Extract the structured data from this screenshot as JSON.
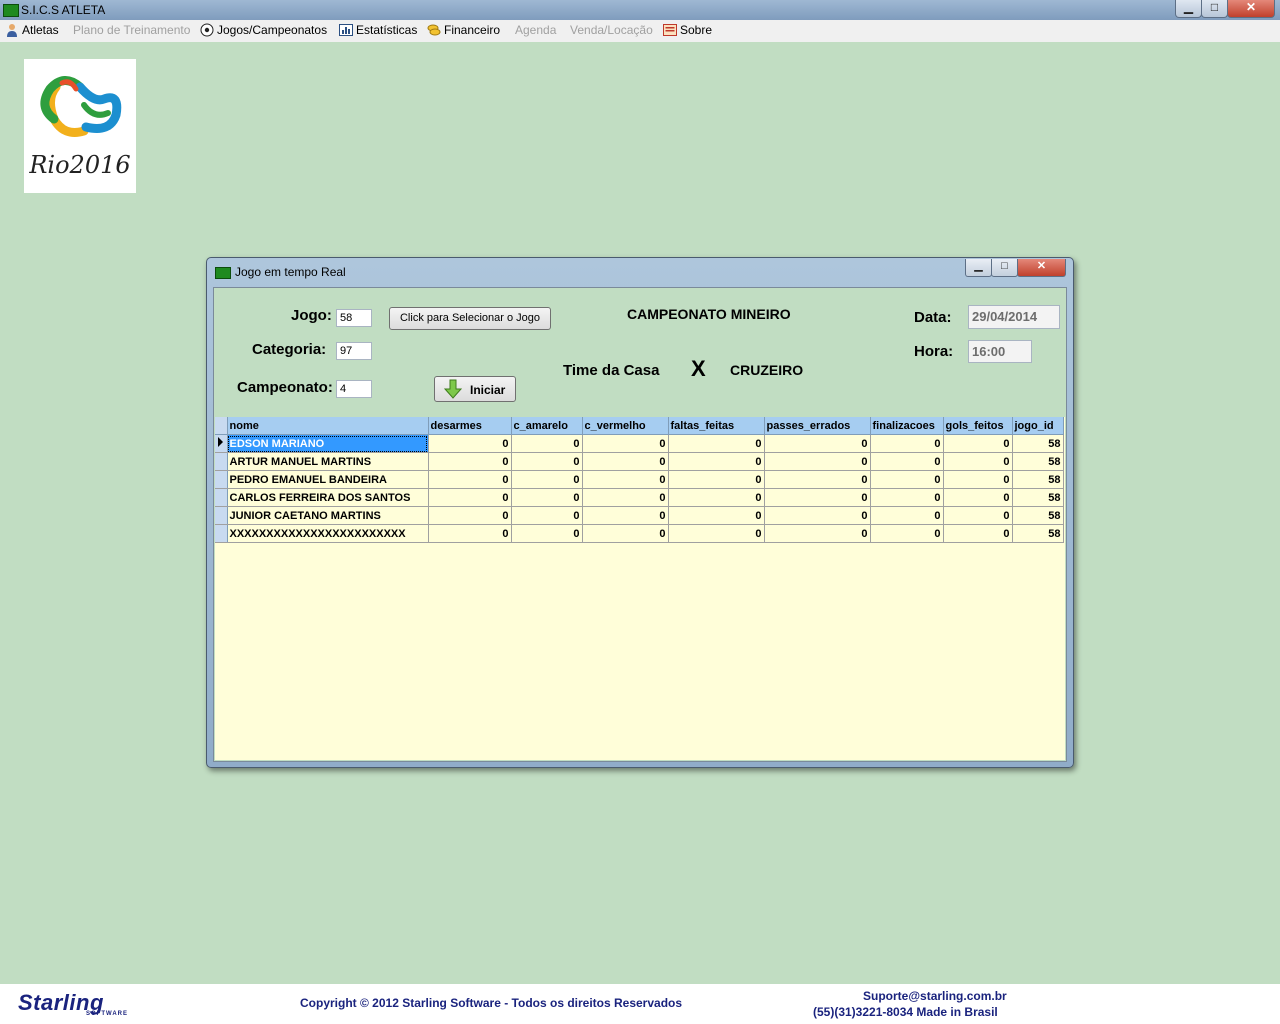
{
  "window": {
    "title": "S.I.C.S ATLETA",
    "min": "▁",
    "max": "□",
    "close": "✕"
  },
  "menu": [
    {
      "label": "Atletas",
      "enabled": true,
      "icon": "person-icon"
    },
    {
      "label": "Plano de Treinamento",
      "enabled": false
    },
    {
      "label": "Jogos/Campeonatos",
      "enabled": true,
      "icon": "soccer-ball-icon"
    },
    {
      "label": "Estatísticas",
      "enabled": true,
      "icon": "chart-icon"
    },
    {
      "label": "Financeiro",
      "enabled": true,
      "icon": "coins-icon"
    },
    {
      "label": "Agenda",
      "enabled": false
    },
    {
      "label": "Venda/Locação",
      "enabled": false
    },
    {
      "label": "Sobre",
      "enabled": true,
      "icon": "info-icon"
    }
  ],
  "logo": {
    "text": "Rio2016"
  },
  "dialog": {
    "title": "Jogo em tempo Real",
    "min": "▁",
    "max": "□",
    "close": "✕",
    "jogo_label": "Jogo:",
    "jogo_value": "58",
    "categoria_label": "Categoria:",
    "categoria_value": "97",
    "campeonato_label": "Campeonato:",
    "campeonato_value": "4",
    "select_button": "Click para Selecionar o Jogo",
    "start_button": "Iniciar",
    "championship_name": "CAMPEONATO MINEIRO",
    "home_team": "Time da Casa",
    "versus": "X",
    "away_team": "CRUZEIRO",
    "data_label": "Data:",
    "data_value": "29/04/2014",
    "hora_label": "Hora:",
    "hora_value": "16:00"
  },
  "grid": {
    "columns": [
      "nome",
      "desarmes",
      "c_amarelo",
      "c_vermelho",
      "faltas_feitas",
      "passes_errados",
      "finalizacoes",
      "gols_feitos",
      "jogo_id"
    ],
    "rows": [
      [
        "EDSON MARIANO",
        "0",
        "0",
        "0",
        "0",
        "0",
        "0",
        "0",
        "58"
      ],
      [
        "ARTUR MANUEL MARTINS",
        "0",
        "0",
        "0",
        "0",
        "0",
        "0",
        "0",
        "58"
      ],
      [
        "PEDRO EMANUEL BANDEIRA",
        "0",
        "0",
        "0",
        "0",
        "0",
        "0",
        "0",
        "58"
      ],
      [
        "CARLOS FERREIRA DOS SANTOS",
        "0",
        "0",
        "0",
        "0",
        "0",
        "0",
        "0",
        "58"
      ],
      [
        "JUNIOR CAETANO MARTINS",
        "0",
        "0",
        "0",
        "0",
        "0",
        "0",
        "0",
        "58"
      ],
      [
        "XXXXXXXXXXXXXXXXXXXXXXXX",
        "0",
        "0",
        "0",
        "0",
        "0",
        "0",
        "0",
        "58"
      ]
    ],
    "selected_row": 0
  },
  "footer": {
    "brand": "Starling",
    "brand_sub": "SOFTWARE",
    "copyright": "Copyright © 2012 Starling Software - Todos os direitos Reservados",
    "email": "Suporte@starling.com.br",
    "phone": "(55)(31)3221-8034 Made in Brasil"
  },
  "colors": {
    "background": "#c1ddc2",
    "grid_background": "#fffed9",
    "header": "#a6cdf1",
    "selection": "#3399ff",
    "footer_text": "#1a237e"
  }
}
